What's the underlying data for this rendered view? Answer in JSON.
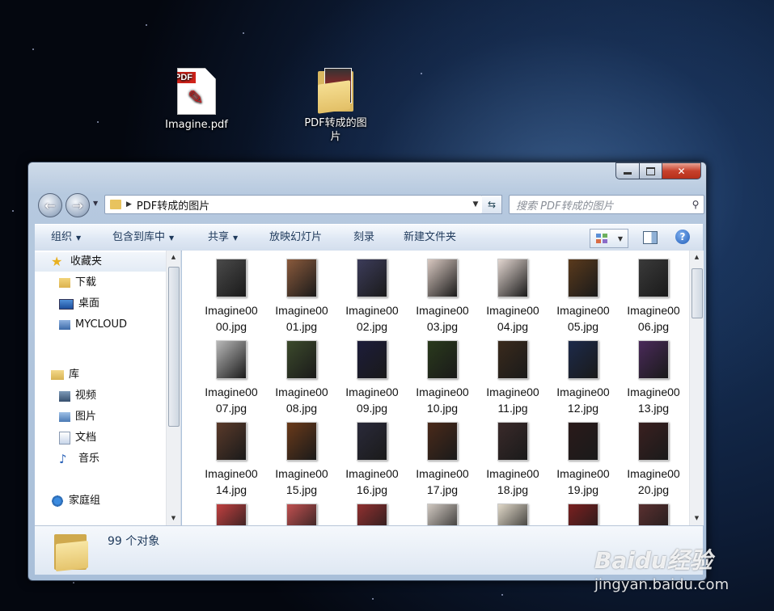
{
  "desktop": {
    "icons": [
      {
        "label": "Imagine.pdf",
        "icon": "pdf-file-icon"
      },
      {
        "label": "PDF转成的图片",
        "icon": "folder-icon"
      }
    ]
  },
  "window": {
    "address": {
      "current_folder": "PDF转成的图片"
    },
    "search": {
      "placeholder": "搜索 PDF转成的图片"
    },
    "toolbar": {
      "organize": "组织",
      "include_library": "包含到库中",
      "share": "共享",
      "slideshow": "放映幻灯片",
      "burn": "刻录",
      "new_folder": "新建文件夹"
    },
    "navpane": {
      "favorites": "收藏夹",
      "downloads": "下载",
      "desktop": "桌面",
      "mycloud": "MYCLOUD",
      "libraries": "库",
      "videos": "视频",
      "pictures": "图片",
      "documents": "文档",
      "music": "音乐",
      "homegroup": "家庭组"
    },
    "files": [
      {
        "l1": "Imagine00",
        "l2": "00.jpg",
        "color": "#4a4a4a"
      },
      {
        "l1": "Imagine00",
        "l2": "01.jpg",
        "color": "#8a5a3c"
      },
      {
        "l1": "Imagine00",
        "l2": "02.jpg",
        "color": "#3c3c5a"
      },
      {
        "l1": "Imagine00",
        "l2": "03.jpg",
        "color": "#d8c8c0"
      },
      {
        "l1": "Imagine00",
        "l2": "04.jpg",
        "color": "#e2d6d0"
      },
      {
        "l1": "Imagine00",
        "l2": "05.jpg",
        "color": "#5a3a1c"
      },
      {
        "l1": "Imagine00",
        "l2": "06.jpg",
        "color": "#3a3a3a"
      },
      {
        "l1": "Imagine00",
        "l2": "07.jpg",
        "color": "#b8b8b8"
      },
      {
        "l1": "Imagine00",
        "l2": "08.jpg",
        "color": "#3c4a2c"
      },
      {
        "l1": "Imagine00",
        "l2": "09.jpg",
        "color": "#1c1c3a"
      },
      {
        "l1": "Imagine00",
        "l2": "10.jpg",
        "color": "#2a3a1c"
      },
      {
        "l1": "Imagine00",
        "l2": "11.jpg",
        "color": "#3a2a1c"
      },
      {
        "l1": "Imagine00",
        "l2": "12.jpg",
        "color": "#1c2a4a"
      },
      {
        "l1": "Imagine00",
        "l2": "13.jpg",
        "color": "#4a2a5a"
      },
      {
        "l1": "Imagine00",
        "l2": "14.jpg",
        "color": "#5a3a2a"
      },
      {
        "l1": "Imagine00",
        "l2": "15.jpg",
        "color": "#6a3a1a"
      },
      {
        "l1": "Imagine00",
        "l2": "16.jpg",
        "color": "#2a2a3a"
      },
      {
        "l1": "Imagine00",
        "l2": "17.jpg",
        "color": "#4a2a1a"
      },
      {
        "l1": "Imagine00",
        "l2": "18.jpg",
        "color": "#3a2a2a"
      },
      {
        "l1": "Imagine00",
        "l2": "19.jpg",
        "color": "#2a1a1a"
      },
      {
        "l1": "Imagine00",
        "l2": "20.jpg",
        "color": "#3a2020"
      },
      {
        "l1": "",
        "l2": "",
        "color": "#c04040"
      },
      {
        "l1": "",
        "l2": "",
        "color": "#c05050"
      },
      {
        "l1": "",
        "l2": "",
        "color": "#903030"
      },
      {
        "l1": "",
        "l2": "",
        "color": "#d0c8c0"
      },
      {
        "l1": "",
        "l2": "",
        "color": "#e0d8c8"
      },
      {
        "l1": "",
        "l2": "",
        "color": "#7a2020"
      },
      {
        "l1": "",
        "l2": "",
        "color": "#5a3030"
      }
    ],
    "status": {
      "count": "99 个对象"
    }
  },
  "watermark": {
    "brand": "Baidu经验",
    "url": "jingyan.baidu.com"
  }
}
